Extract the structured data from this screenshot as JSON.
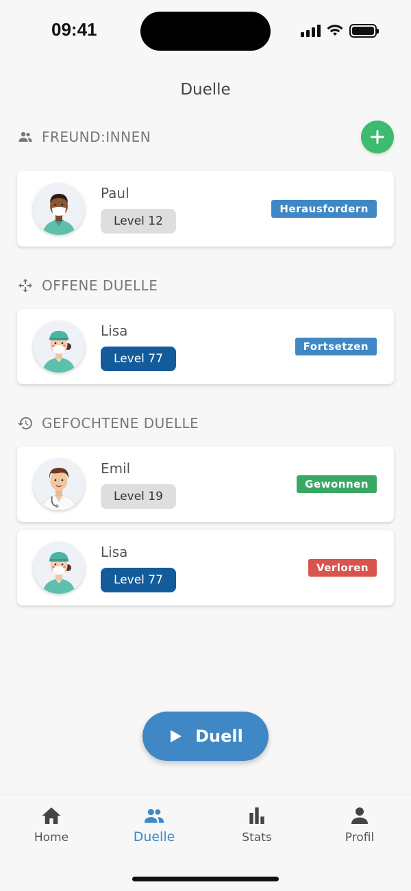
{
  "status_bar": {
    "time": "09:41"
  },
  "header": {
    "title": "Duelle"
  },
  "sections": {
    "friends": {
      "label": "FREUND:INNEN",
      "icon": "people-icon"
    },
    "open": {
      "label": "OFFENE DUELLE",
      "icon": "move-arrows-icon"
    },
    "fought": {
      "label": "GEFOCHTENE DUELLE",
      "icon": "history-icon"
    }
  },
  "cards": [
    {
      "name": "Paul",
      "level": "Level 12",
      "level_style": "gray",
      "action": "Herausfordern",
      "action_color": "#3f88c5",
      "avatar": "male-nurse-mask-avatar"
    },
    {
      "name": "Lisa",
      "level": "Level 77",
      "level_style": "blue",
      "action": "Fortsetzen",
      "action_color": "#3f88c5",
      "avatar": "female-nurse-cap-mask-avatar"
    },
    {
      "name": "Emil",
      "level": "Level 19",
      "level_style": "gray",
      "action": "Gewonnen",
      "action_color": "#3aa865",
      "avatar": "male-doctor-stethoscope-avatar"
    },
    {
      "name": "Lisa",
      "level": "Level 77",
      "level_style": "blue",
      "action": "Verloren",
      "action_color": "#d9534f",
      "avatar": "female-nurse-cap-mask-avatar"
    }
  ],
  "primary_action": {
    "label": "Duell",
    "icon": "play-icon"
  },
  "bottom_nav": {
    "items": [
      {
        "label": "Home",
        "icon": "home-icon",
        "active": false
      },
      {
        "label": "Duelle",
        "icon": "people-icon",
        "active": true
      },
      {
        "label": "Stats",
        "icon": "bar-chart-icon",
        "active": false
      },
      {
        "label": "Profil",
        "icon": "person-icon",
        "active": false
      }
    ]
  },
  "colors": {
    "accent": "#3f88c5",
    "success": "#3aa865",
    "danger": "#d9534f",
    "level_dark": "#135b9b",
    "add_button": "#3dbb6e"
  }
}
